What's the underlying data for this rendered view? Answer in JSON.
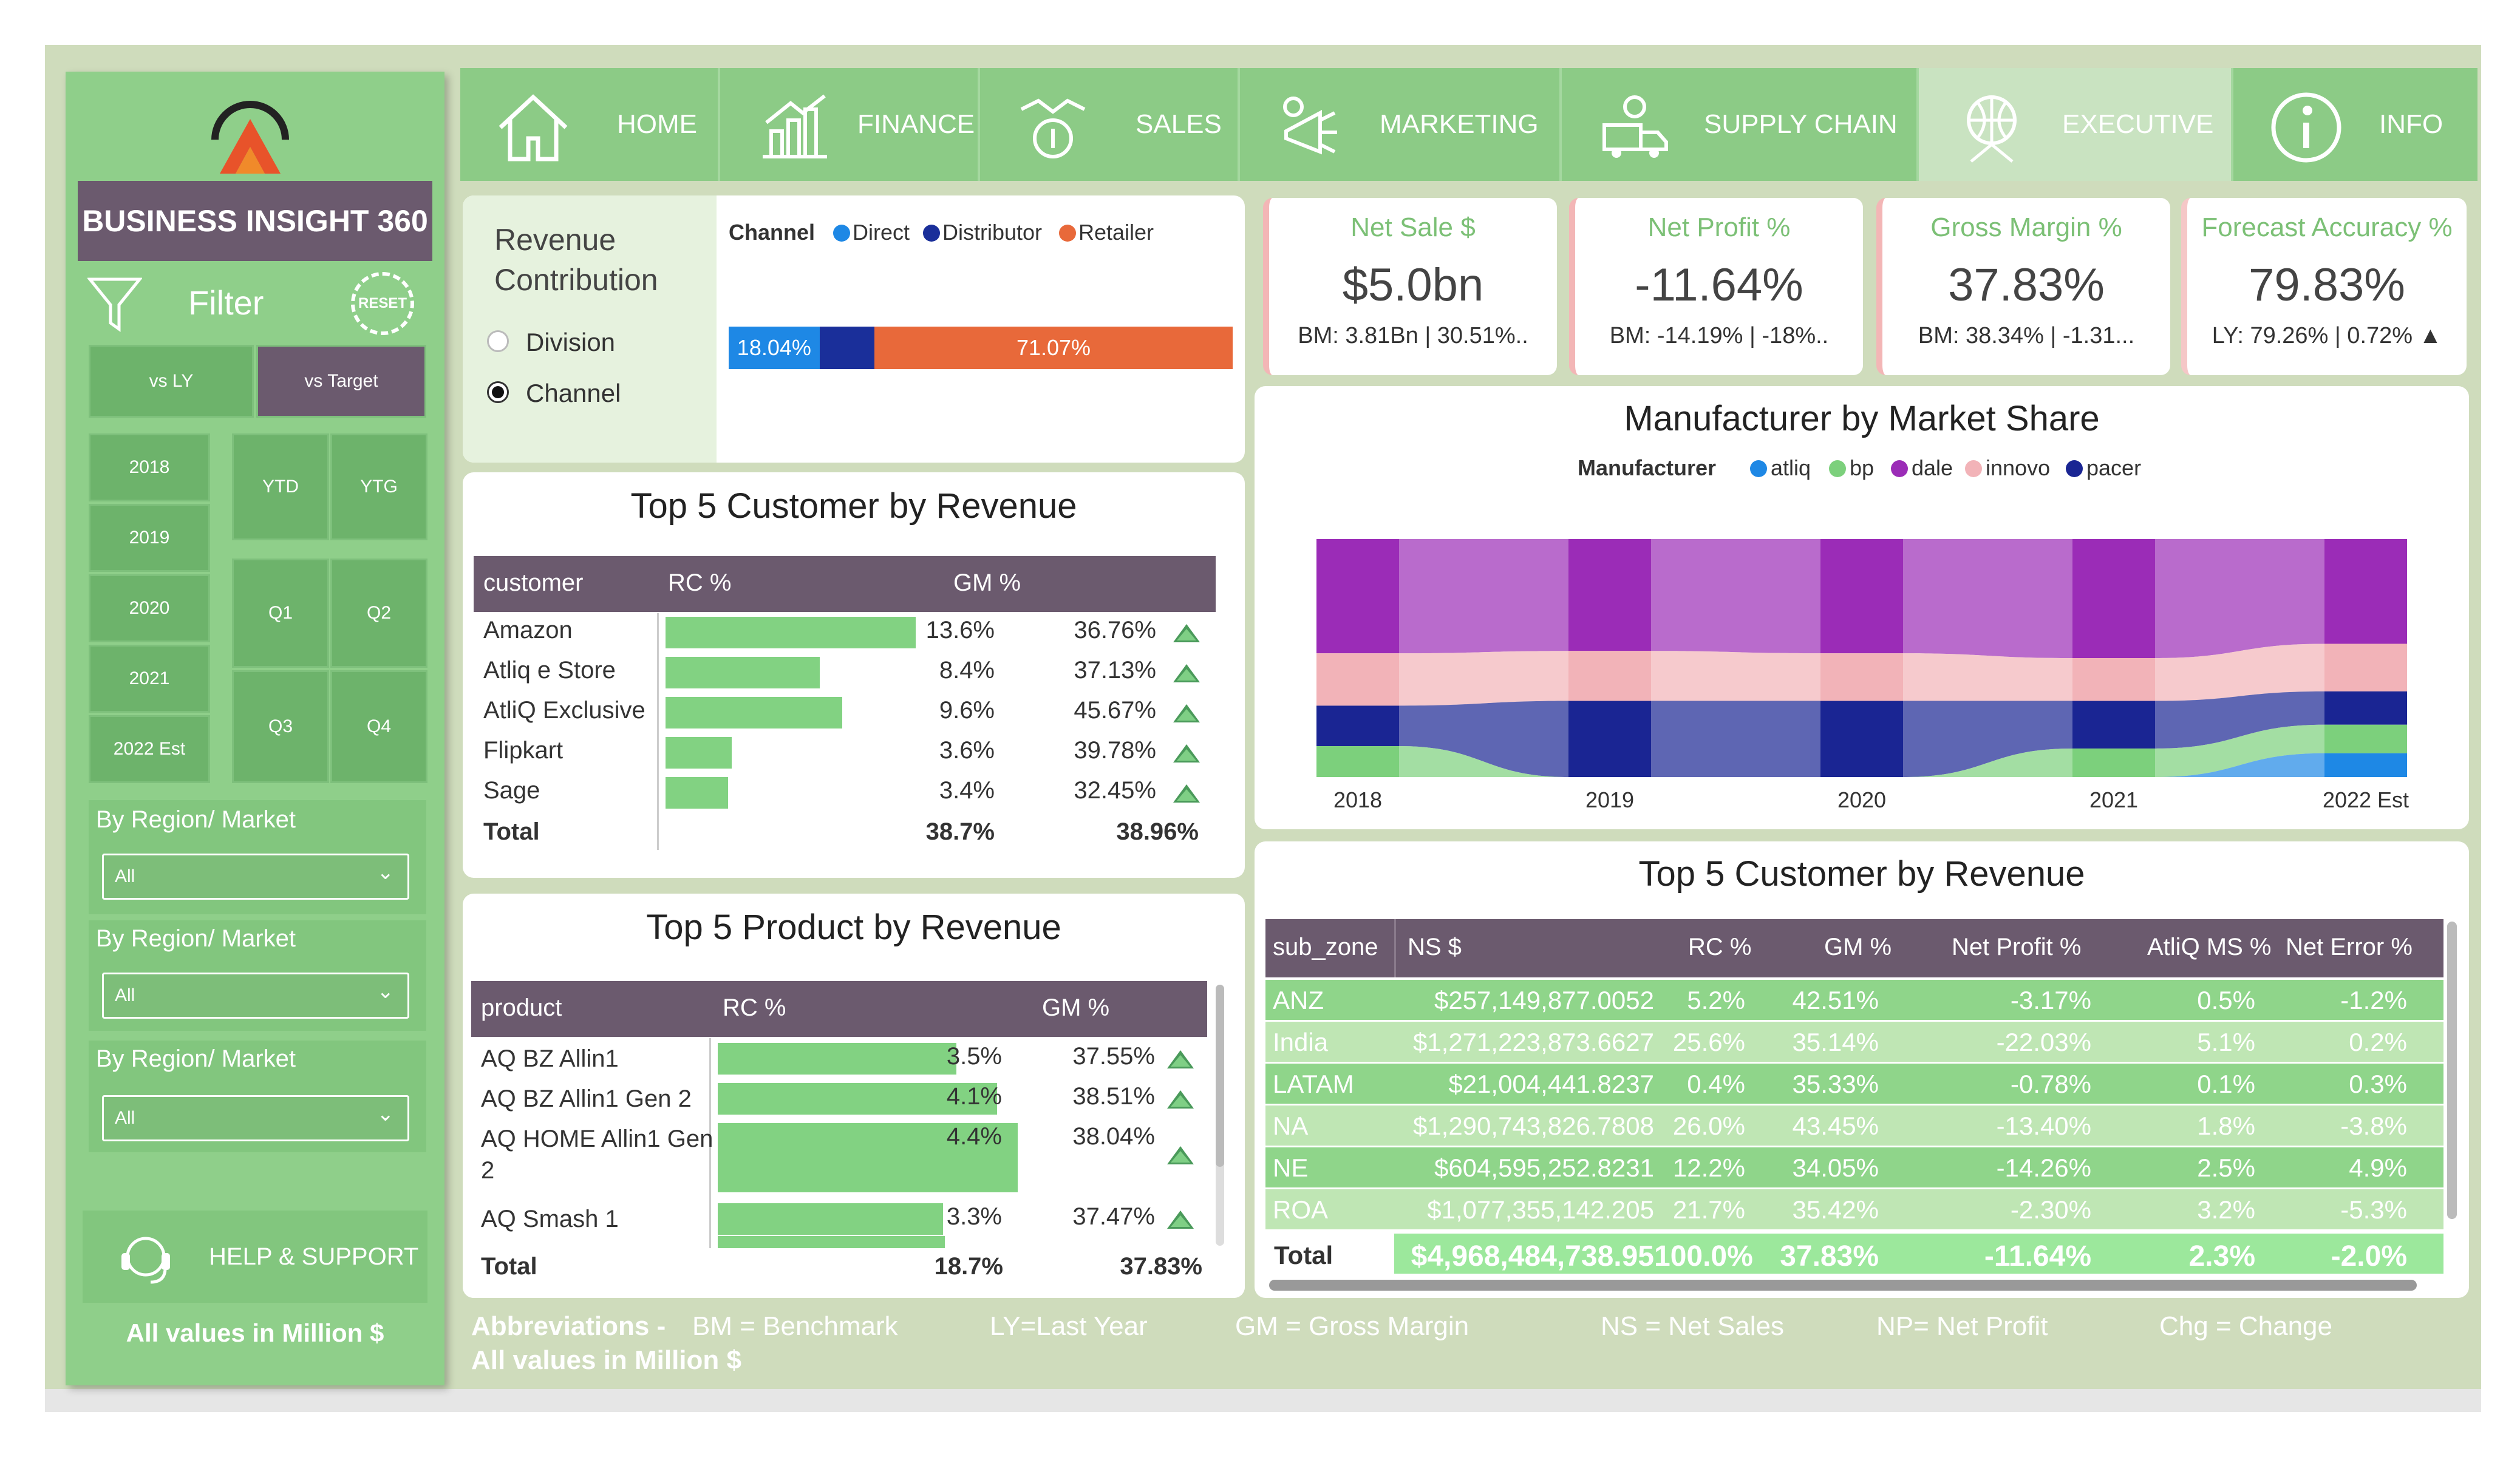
{
  "app": {
    "title": "BUSINESS INSIGHT 360",
    "all_values_note": "All values in Million $"
  },
  "sidebar": {
    "filter_label": "Filter",
    "reset_label": "RESET",
    "compare": {
      "vs_ly": "vs LY",
      "vs_target": "vs Target",
      "selected": "vs Target"
    },
    "years": [
      "2018",
      "2019",
      "2020",
      "2021",
      "2022 Est"
    ],
    "periods": [
      "YTD",
      "YTG",
      "Q1",
      "Q2",
      "Q3",
      "Q4"
    ],
    "filters": [
      {
        "label": "By Region/ Market",
        "value": "All"
      },
      {
        "label": "By Region/ Market",
        "value": "All"
      },
      {
        "label": "By Region/ Market",
        "value": "All"
      }
    ],
    "help_label": "HELP & SUPPORT"
  },
  "nav": {
    "items": [
      "HOME",
      "FINANCE",
      "SALES",
      "MARKETING",
      "SUPPLY CHAIN",
      "EXECUTIVE",
      "INFO"
    ],
    "active": "EXECUTIVE",
    "icons": [
      "home-icon",
      "finance-icon",
      "sales-icon",
      "marketing-icon",
      "supply-chain-icon",
      "executive-icon",
      "info-icon"
    ]
  },
  "revenue_contribution": {
    "title": "Revenue Contribution",
    "options": [
      "Division",
      "Channel"
    ],
    "selected": "Channel",
    "legend_title": "Channel",
    "legend": [
      {
        "name": "Direct",
        "color": "#1e88e5"
      },
      {
        "name": "Distributor",
        "color": "#1a2f9a"
      },
      {
        "name": "Retailer",
        "color": "#e8693a"
      }
    ],
    "bar_values": [
      18.04,
      10.89,
      71.07
    ],
    "bar_labels": [
      "18.04%",
      "",
      "71.07%"
    ]
  },
  "kpis": [
    {
      "title": "Net Sale $",
      "value": "$5.0bn",
      "sub": "BM: 3.81Bn | 30.51%.."
    },
    {
      "title": "Net Profit %",
      "value": "-11.64%",
      "sub": "BM: -14.19% | -18%.."
    },
    {
      "title": "Gross Margin %",
      "value": "37.83%",
      "sub": "BM: 38.34% | -1.31..."
    },
    {
      "title": "Forecast Accuracy %",
      "value": "79.83%",
      "sub": "LY: 79.26% | 0.72% ▲"
    }
  ],
  "top_customers": {
    "title": "Top 5 Customer by Revenue",
    "headers": [
      "customer",
      "RC %",
      "GM %"
    ],
    "rows": [
      {
        "name": "Amazon",
        "rc": "13.6%",
        "rc_value": 13.6,
        "gm": "36.76%"
      },
      {
        "name": "Atliq e Store",
        "rc": "8.4%",
        "rc_value": 8.4,
        "gm": "37.13%"
      },
      {
        "name": "AtliQ Exclusive",
        "rc": "9.6%",
        "rc_value": 9.6,
        "gm": "45.67%"
      },
      {
        "name": "Flipkart",
        "rc": "3.6%",
        "rc_value": 3.6,
        "gm": "39.78%"
      },
      {
        "name": "Sage",
        "rc": "3.4%",
        "rc_value": 3.4,
        "gm": "32.45%"
      }
    ],
    "total": {
      "label": "Total",
      "rc": "38.7%",
      "gm": "38.96%"
    }
  },
  "top_products": {
    "title": "Top 5 Product by Revenue",
    "headers": [
      "product",
      "RC %",
      "GM %"
    ],
    "rows": [
      {
        "name": "AQ BZ Allin1",
        "rc": "3.5%",
        "rc_value": 3.5,
        "gm": "37.55%"
      },
      {
        "name": "AQ BZ Allin1 Gen 2",
        "rc": "4.1%",
        "rc_value": 4.1,
        "gm": "38.51%"
      },
      {
        "name": "AQ HOME Allin1 Gen 2",
        "rc": "4.4%",
        "rc_value": 4.4,
        "gm": "38.04%"
      },
      {
        "name": "AQ Smash 1",
        "rc": "3.3%",
        "rc_value": 3.3,
        "gm": "37.47%"
      }
    ],
    "total": {
      "label": "Total",
      "rc": "18.7%",
      "gm": "37.83%"
    }
  },
  "market_share": {
    "title": "Manufacturer by Market Share",
    "legend_title": "Manufacturer"
  },
  "chart_data": {
    "type": "area",
    "title": "Manufacturer by Market Share",
    "legend_title": "Manufacturer",
    "legend_position": "top",
    "x": [
      "2018",
      "2019",
      "2020",
      "2021",
      "2022 Est"
    ],
    "series": [
      {
        "name": "atliq",
        "color": "#1e88e5",
        "values": [
          0,
          0,
          0,
          0,
          10
        ]
      },
      {
        "name": "bp",
        "color": "#7cd07c",
        "values": [
          13,
          0,
          0,
          12,
          12
        ]
      },
      {
        "name": "dale",
        "color": "#9b2cb7",
        "values": [
          48,
          47,
          48,
          50,
          44
        ]
      },
      {
        "name": "innovo",
        "color": "#f2b3b8",
        "values": [
          22,
          21,
          20,
          18,
          20
        ]
      },
      {
        "name": "pacer",
        "color": "#1a2593",
        "values": [
          17,
          32,
          32,
          20,
          14
        ]
      }
    ],
    "ylim": [
      0,
      100
    ],
    "grid": false
  },
  "sub_zone": {
    "title": "Top 5 Customer by Revenue",
    "headers": [
      "sub_zone",
      "NS $",
      "RC %",
      "GM %",
      "Net Profit %",
      "AtliQ MS %",
      "Net Error %"
    ],
    "rows": [
      [
        "ANZ",
        "$257,149,877.0052",
        "5.2%",
        "42.51%",
        "-3.17%",
        "0.5%",
        "-1.2%"
      ],
      [
        "India",
        "$1,271,223,873.6627",
        "25.6%",
        "35.14%",
        "-22.03%",
        "5.1%",
        "0.2%"
      ],
      [
        "LATAM",
        "$21,004,441.8237",
        "0.4%",
        "35.33%",
        "-0.78%",
        "0.1%",
        "0.3%"
      ],
      [
        "NA",
        "$1,290,743,826.7808",
        "26.0%",
        "43.45%",
        "-13.40%",
        "1.8%",
        "-3.8%"
      ],
      [
        "NE",
        "$604,595,252.8231",
        "12.2%",
        "34.05%",
        "-14.26%",
        "2.5%",
        "4.9%"
      ],
      [
        "ROA",
        "$1,077,355,142.205",
        "21.7%",
        "35.42%",
        "-2.30%",
        "3.2%",
        "-5.3%"
      ]
    ],
    "total": [
      "Total",
      "$4,968,484,738.95",
      "100.0%",
      "37.83%",
      "-11.64%",
      "2.3%",
      "-2.0%"
    ]
  },
  "abbreviations": {
    "label": "Abbreviations -",
    "items": [
      "BM = Benchmark",
      "LY=Last Year",
      "GM = Gross Margin",
      "NS = Net Sales",
      "NP= Net Profit",
      "Chg = Change"
    ],
    "note": "All values in Million $"
  },
  "colors": {
    "sidebar": "#8fcf8a",
    "header_purple": "#6b5a6e",
    "bar_green": "#82d282",
    "accent_red": "#f3b6b6"
  }
}
